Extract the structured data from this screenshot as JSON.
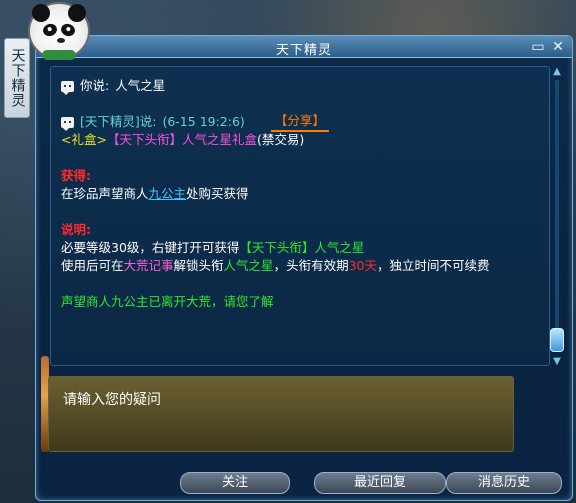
{
  "side_tab": {
    "label": "天下精灵"
  },
  "window": {
    "title": "天下精灵"
  },
  "chat": {
    "line1": {
      "speaker": "你说:",
      "text": "人气之星"
    },
    "line2": {
      "speaker": "[天下精灵]说:",
      "time": "(6-15 19:2:6)",
      "share": "【分享】"
    },
    "line3": {
      "prefix": "<礼盒>",
      "item": "【天下头衔】",
      "item_name": "人气之星礼盒",
      "suffix": "(禁交易)"
    },
    "obtain_heading": "获得:",
    "obtain_pre": "在珍品声望商人",
    "obtain_link": "九公主",
    "obtain_post": "处购买获得",
    "desc_heading": "说明:",
    "desc1_pre": "必要等级30级，右键打开可获得",
    "desc1_item": "【天下头衔】人气之星",
    "desc2_pre": "使用后可在",
    "desc2_place": "大荒记事",
    "desc2_mid": "解锁头衔",
    "desc2_title": "人气之星",
    "desc2_mid2": "，头衔有效期",
    "desc2_days": "30天",
    "desc2_end": "，独立时间不可续费",
    "notice": "声望商人九公主已离开大荒，请您了解"
  },
  "input": {
    "placeholder": "请输入您的疑问"
  },
  "buttons": {
    "follow": "关注",
    "recent": "最近回复",
    "history": "消息历史"
  },
  "window_controls": {
    "minimize": "▭",
    "close": "✕"
  },
  "scroll": {
    "up": "▲",
    "down": "▼"
  },
  "colors": {
    "accent": "#63d1df",
    "share": "#ff7a00",
    "heading": "#ff2a2a",
    "item": "#ff4fe0",
    "notice": "#2ee82e"
  }
}
